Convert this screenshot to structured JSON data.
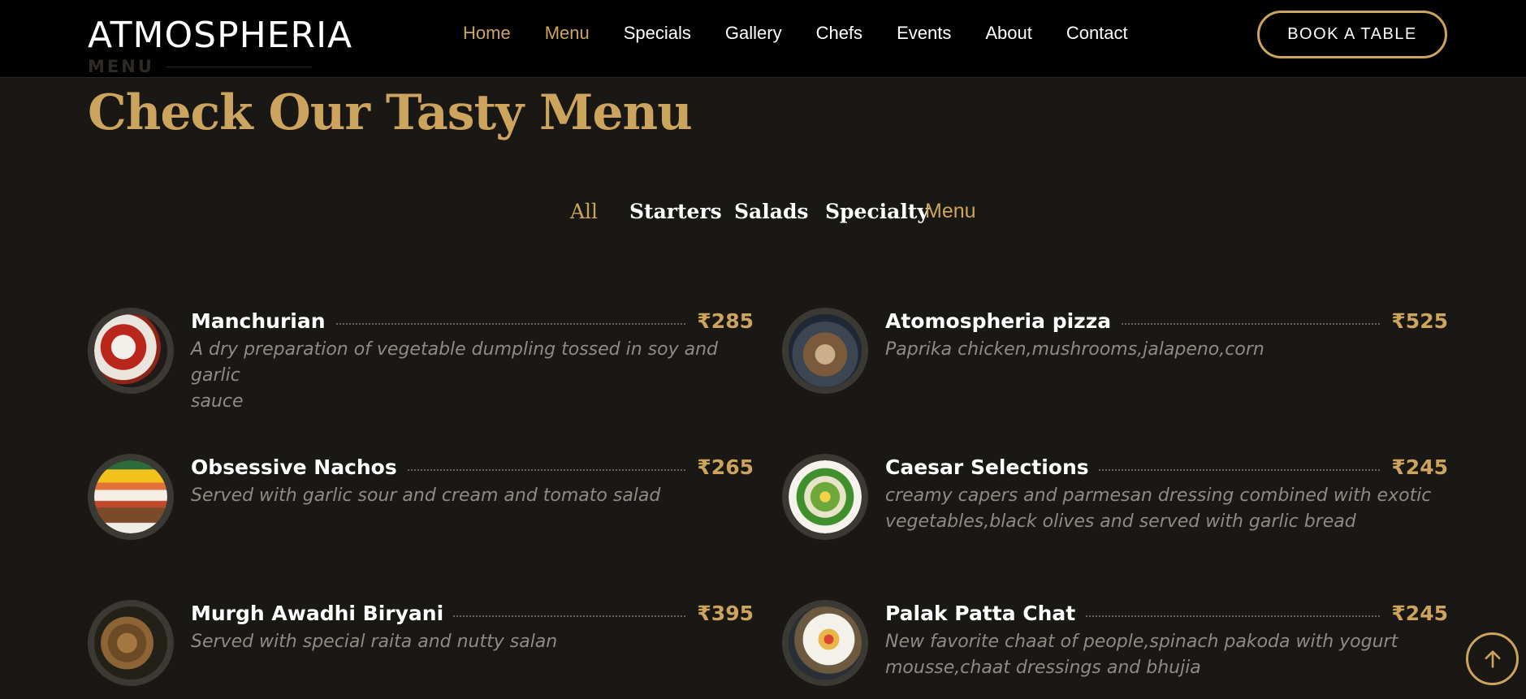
{
  "header": {
    "logo": "ATMOSPHERIA",
    "nav": [
      "Home",
      "Menu",
      "Specials",
      "Gallery",
      "Chefs",
      "Events",
      "About",
      "Contact"
    ],
    "book_button": "BOOK A TABLE"
  },
  "section": {
    "tag": "MENU",
    "title": "Check Our Tasty Menu"
  },
  "filters": [
    "All",
    "Starters",
    "Salads",
    "Specialty",
    "Menu"
  ],
  "items": [
    {
      "name": "Manchurian",
      "price": "₹285",
      "desc_lines": [
        "A dry preparation of vegetable dumpling tossed in soy and garlic",
        "sauce"
      ]
    },
    {
      "name": "Atomospheria pizza",
      "price": "₹525",
      "desc_lines": [
        "Paprika chicken,mushrooms,jalapeno,corn"
      ]
    },
    {
      "name": "Obsessive Nachos",
      "price": "₹265",
      "desc_lines": [
        "Served with garlic sour and cream and tomato salad"
      ]
    },
    {
      "name": "Caesar Selections",
      "price": "₹245",
      "desc_lines": [
        "creamy capers and parmesan dressing combined with exotic",
        "vegetables,black olives and served with garlic bread"
      ]
    },
    {
      "name": "Murgh Awadhi Biryani",
      "price": "₹395",
      "desc_lines": [
        "Served with special raita and nutty salan"
      ]
    },
    {
      "name": "Palak Patta Chat",
      "price": "₹245",
      "desc_lines": [
        "New favorite chaat of people,spinach pakoda with yogurt",
        "mousse,chaat dressings and bhujia"
      ]
    }
  ],
  "icons": {
    "scroll_top": "arrow-up-icon"
  },
  "colors": {
    "accent": "#cda45e",
    "background": "#1a1814",
    "header": "#000000",
    "muted_text": "#8e8a84"
  }
}
